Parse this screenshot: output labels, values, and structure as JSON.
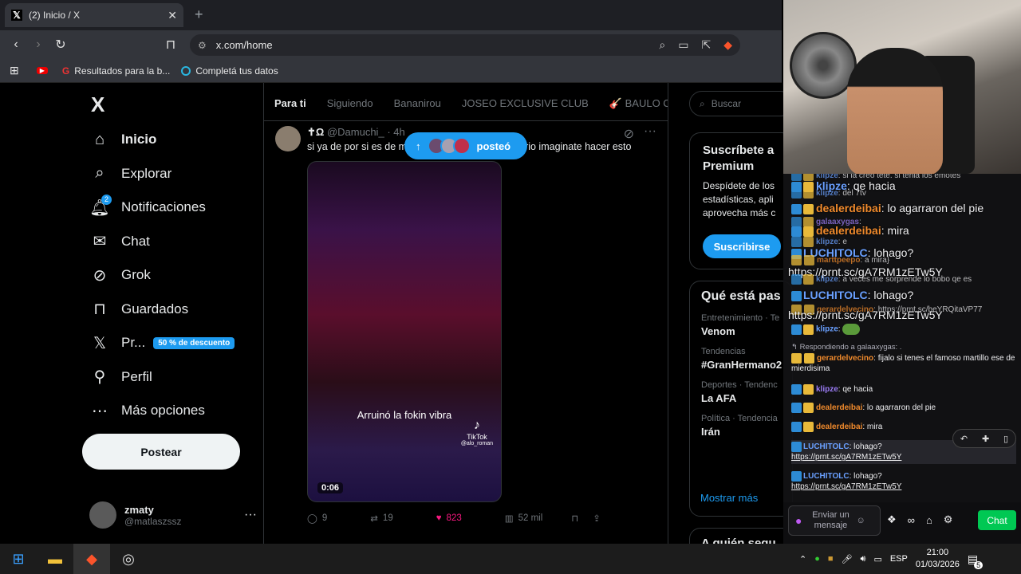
{
  "browser": {
    "tab_title": "(2) Inicio / X",
    "url": "x.com/home",
    "bookmarks": [
      {
        "label": "Resultados para la b..."
      },
      {
        "label": "Completá tus datos"
      }
    ]
  },
  "sidebar": {
    "logo": "X",
    "items": [
      {
        "label": "Inicio",
        "icon": "home-icon"
      },
      {
        "label": "Explorar",
        "icon": "search-icon"
      },
      {
        "label": "Notificaciones",
        "icon": "bell-icon",
        "badge": "2"
      },
      {
        "label": "Chat",
        "icon": "mail-icon"
      },
      {
        "label": "Grok",
        "icon": "grok-icon"
      },
      {
        "label": "Guardados",
        "icon": "bookmark-icon"
      },
      {
        "label": "Pr...",
        "icon": "x-premium-icon",
        "badge": "50 % de descuento"
      },
      {
        "label": "Perfil",
        "icon": "person-icon"
      },
      {
        "label": "Más opciones",
        "icon": "more-circle-icon"
      }
    ],
    "post_button": "Postear",
    "account": {
      "name": "zmaty",
      "handle": "@matlaszssz"
    }
  },
  "feed": {
    "tabs": [
      "Para ti",
      "Siguiendo",
      "Bananirou",
      "JOSEO EXCLUSIVE CLUB",
      "🎸 BAULO CL"
    ],
    "new_posts_pill": "posteó",
    "post": {
      "author_prefix": "✝Ω",
      "handle": "@Damuchi_",
      "time": "· 4h",
      "text_left": "si ya de por si es de m",
      "text_right": "rio imaginate hacer esto",
      "video_caption": "Arruinó la fokin vibra",
      "video_watermark": "TikTok",
      "video_user": "@alo_roman",
      "video_duration": "0:06",
      "replies": "9",
      "reposts": "19",
      "likes": "823",
      "views": "52 mil"
    }
  },
  "right": {
    "search_placeholder": "Buscar",
    "premium_title": "Suscríbete a Premium",
    "premium_text": "Despídete de los estadísticas, apli aprovecha más c",
    "subscribe_button": "Suscribirse",
    "trends_title": "Qué está pas",
    "trends": [
      {
        "context": "Entretenimiento · Te",
        "name": "Venom"
      },
      {
        "context": "Tendencias",
        "name": "#GranHermano2"
      },
      {
        "context": "Deportes · Tendenc",
        "name": "La AFA"
      },
      {
        "context": "Política · Tendencia",
        "name": "Irán"
      }
    ],
    "show_more": "Mostrar más",
    "who_to_follow": "A quién segu"
  },
  "chat": {
    "messages": [
      {
        "user": "klipze",
        "text": "si la creo tete. si tenia los emotes",
        "kind": "small"
      },
      {
        "user": "klipze",
        "text": "qe hacia",
        "kind": "big"
      },
      {
        "user": "klipze",
        "text": "del 7tv",
        "kind": "small"
      },
      {
        "user": "dealerdeibai",
        "text": "lo agarraron del pie",
        "kind": "big"
      },
      {
        "user": "galaaxygas",
        "text": "",
        "kind": "small"
      },
      {
        "user": "dealerdeibai",
        "text": "mira",
        "kind": "big"
      },
      {
        "user": "klipze",
        "text": "e",
        "kind": "small"
      },
      {
        "user": "LUCHITOLC",
        "text": "lohago?",
        "kind": "big"
      },
      {
        "user": "marttpeepo",
        "text": "a mira}",
        "kind": "small"
      },
      {
        "user": "",
        "text": "https://prnt.sc/gA7RM1zETw5Y",
        "kind": "big"
      },
      {
        "user": "klipze",
        "text": "a veces me sorprende lo bobo qe es",
        "kind": "small"
      },
      {
        "user": "LUCHITOLC",
        "text": "lohago?",
        "kind": "big"
      },
      {
        "user": "gerardelvecino",
        "text": "https://prnt.sc/beYRQitaVP77",
        "kind": "small"
      },
      {
        "user": "",
        "text": "https://prnt.sc/gA7RM1zETw5Y",
        "kind": "big"
      },
      {
        "user": "klipze",
        "text": "",
        "kind": "small"
      },
      {
        "user": "",
        "text": "Respondiendo a galaaxygas: .",
        "kind": "reply"
      },
      {
        "user": "gerardelvecino",
        "text": "fijalo si tenes el famoso martillo ese de mierdisima",
        "kind": "small"
      },
      {
        "user": "klipze",
        "text": "qe hacia",
        "kind": "small"
      },
      {
        "user": "dealerdeibai",
        "text": "lo agarraron del pie",
        "kind": "small"
      },
      {
        "user": "dealerdeibai",
        "text": "mira",
        "kind": "small"
      },
      {
        "user": "LUCHITOLC",
        "text": "lohago?",
        "link": "https://prnt.sc/gA7RM1zETw5Y",
        "kind": "small"
      },
      {
        "user": "LUCHITOLC",
        "text": "lohago?",
        "link": "https://prnt.sc/gA7RM1zETw5Y",
        "kind": "small"
      }
    ],
    "input_placeholder": "Enviar un mensaje",
    "chat_button": "Chat"
  },
  "taskbar": {
    "language": "ESP",
    "time": "21:00",
    "date": "01/03/2026",
    "notifications": "5"
  }
}
